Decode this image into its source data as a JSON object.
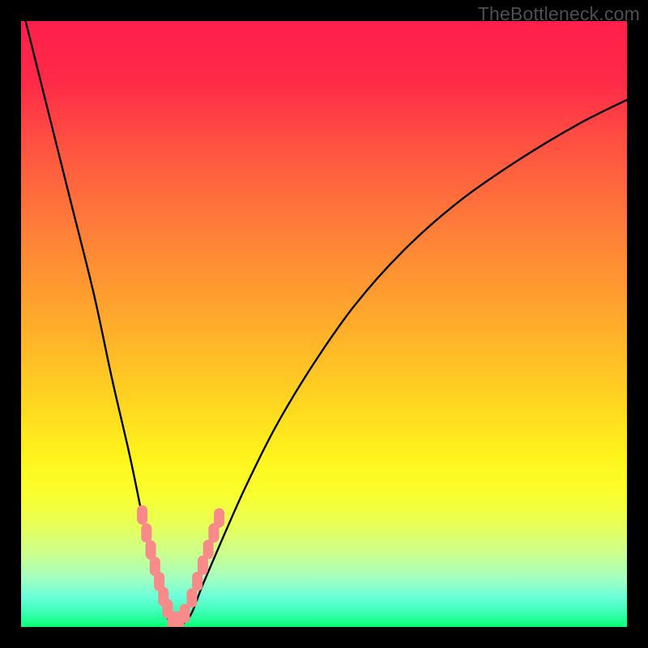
{
  "watermark": {
    "text": "TheBottleneck.com"
  },
  "chart_data": {
    "type": "line",
    "title": "",
    "xlabel": "",
    "ylabel": "",
    "xlim": [
      0,
      100
    ],
    "ylim": [
      0,
      100
    ],
    "grid": false,
    "legend": false,
    "series": [
      {
        "name": "bottleneck-curve",
        "x": [
          0,
          4,
          8,
          12,
          15,
          18,
          20.5,
          22.5,
          24,
          25,
          26,
          28,
          30,
          33,
          37,
          42,
          48,
          55,
          63,
          72,
          82,
          92,
          100
        ],
        "y": [
          103,
          87,
          71,
          55,
          41,
          28,
          16,
          8,
          2,
          0,
          0,
          2,
          7,
          14,
          23,
          33,
          43,
          53,
          62,
          70,
          77,
          83,
          87
        ]
      },
      {
        "name": "marker-dots",
        "x": [
          20.0,
          20.7,
          21.4,
          22.1,
          22.8,
          23.5,
          24.2,
          25.0,
          26.0,
          27.0,
          28.2,
          29.1,
          30.0,
          30.9,
          31.8,
          32.7
        ],
        "y": [
          18.5,
          15.5,
          12.7,
          10.0,
          7.5,
          5.0,
          3.0,
          1.0,
          1.0,
          2.2,
          4.8,
          7.5,
          10.2,
          12.8,
          15.5,
          18.0
        ]
      }
    ],
    "colors": {
      "curve": "#000000",
      "markers": "#f88a8a",
      "gradient_top": "#ff1f4b",
      "gradient_bottom": "#09ff73"
    }
  }
}
